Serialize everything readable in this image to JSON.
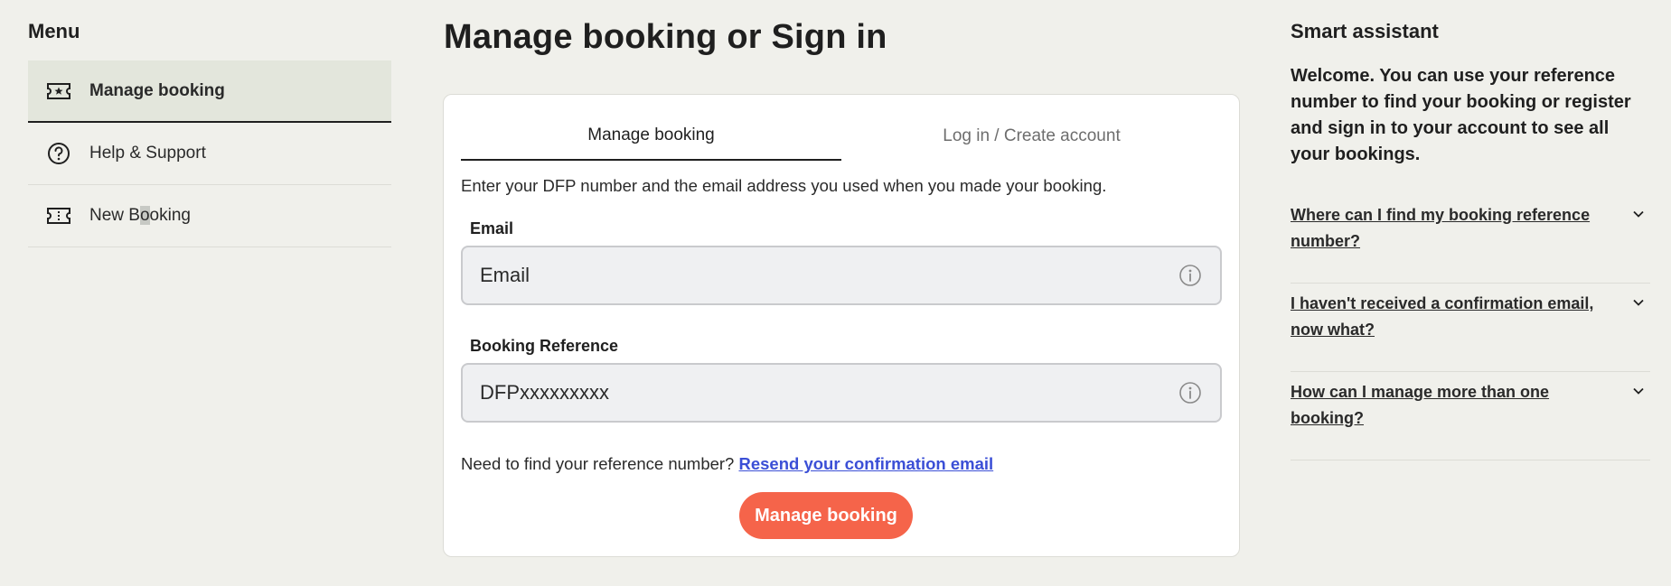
{
  "menu": {
    "title": "Menu",
    "items": [
      {
        "label": "Manage booking"
      },
      {
        "label": "Help & Support"
      },
      {
        "label_pre": "New B",
        "label_hl": "o",
        "label_post": "oking"
      }
    ]
  },
  "main": {
    "title": "Manage booking or Sign in",
    "tabs": [
      {
        "label": "Manage booking"
      },
      {
        "label": "Log in / Create account"
      }
    ],
    "intro": "Enter your DFP number and the email address you used when you made your booking.",
    "email": {
      "label": "Email",
      "placeholder": "Email",
      "value": ""
    },
    "reference": {
      "label": "Booking Reference",
      "placeholder": "DFPxxxxxxxxx",
      "value": ""
    },
    "help_text": "Need to find your reference number?",
    "help_link": "Resend your confirmation email",
    "submit_label": "Manage booking"
  },
  "assistant": {
    "title": "Smart assistant",
    "welcome": "Welcome. You can use your reference number to find your booking or register and sign in to your account to see all your bookings.",
    "faqs": [
      {
        "question": "Where can I find my booking reference number?"
      },
      {
        "question": "I haven't received a confirmation email, now what?"
      },
      {
        "question": "How can I manage more than one booking?"
      }
    ]
  },
  "colors": {
    "background": "#f0f0eb",
    "accent": "#f5644a",
    "link": "#3b4fd6",
    "active_menu": "#e3e6dc"
  },
  "icons": [
    "ticket-star-icon",
    "help-circle-icon",
    "ticket-icon",
    "info-icon",
    "chevron-down-icon"
  ]
}
